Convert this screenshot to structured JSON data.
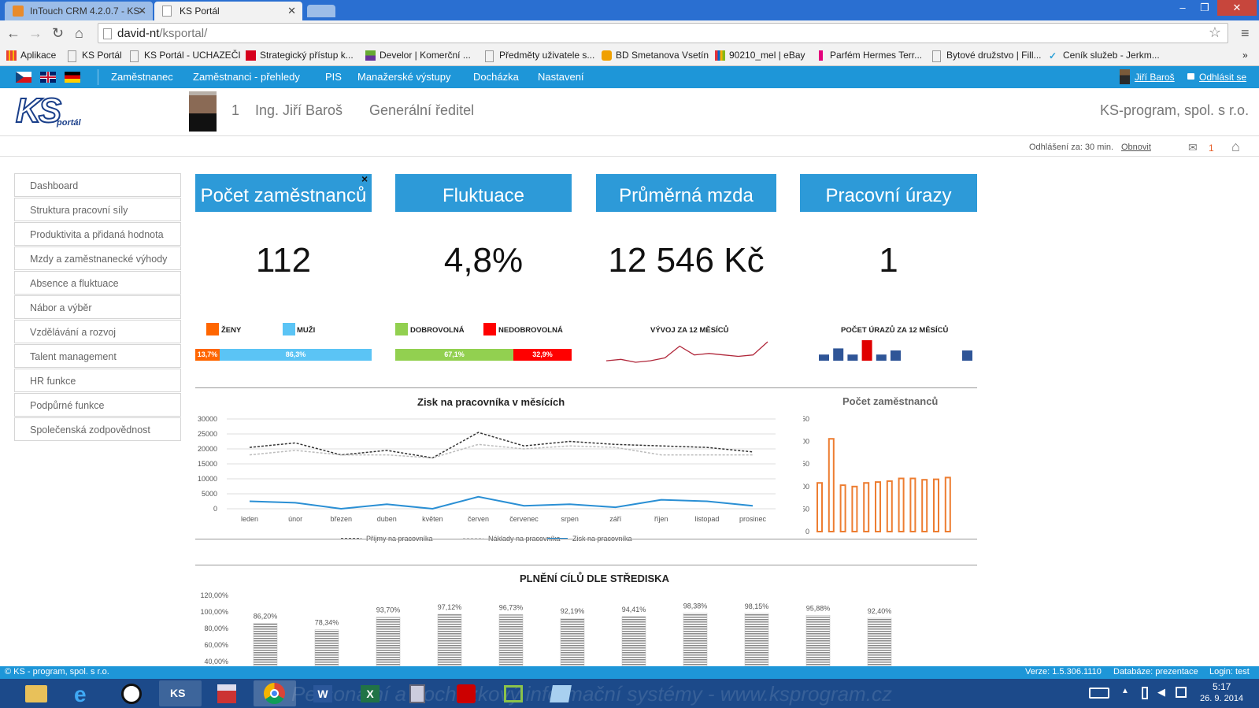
{
  "browser": {
    "tabs": [
      {
        "title": "InTouch CRM 4.2.0.7 - KS-",
        "active": false
      },
      {
        "title": "KS Portál",
        "active": true
      }
    ],
    "url_host": "david-nt",
    "url_path": "/ksportal/",
    "bookmarks": [
      "Aplikace",
      "KS Portál",
      "KS Portál - UCHAZEČI",
      "Strategický přístup k...",
      "Develor | Komerční ...",
      "Předměty uživatele s...",
      "BD Smetanova Vsetín",
      "90210_mel | eBay",
      "Parfém Hermes Terr...",
      "Bytové družstvo | Fill...",
      "Ceník služeb - Jerkm..."
    ]
  },
  "nav": {
    "items": [
      "Zaměstnanec",
      "Zaměstnanci - přehledy",
      "PIS",
      "Manažerské výstupy",
      "Docházka",
      "Nastavení"
    ],
    "user_link": "Jiří Baroš",
    "logout": "Odhlásit se"
  },
  "header": {
    "logo_text": "KS",
    "logo_sub": "portál",
    "user_number": "1",
    "user_name": "Ing. Jiří Baroš",
    "user_role": "Generální ředitel",
    "company": "KS-program, spol. s r.o."
  },
  "session": {
    "logout_in": "Odhlášení za: 30 min.",
    "refresh": "Obnovit",
    "messages": "1"
  },
  "sidebar": {
    "items": [
      "Dashboard",
      "Struktura pracovní síly",
      "Produktivita a přidaná hodnota",
      "Mzdy a zaměstnanecké výhody",
      "Absence a fluktuace",
      "Nábor a výběr",
      "Vzdělávání a rozvoj",
      "Talent management",
      "HR funkce",
      "Podpůrné funkce",
      "Společenská zodpovědnost"
    ]
  },
  "kpis": {
    "employees": {
      "title": "Počet zaměstnanců",
      "value": "112",
      "close": "×"
    },
    "turnover": {
      "title": "Fluktuace",
      "value": "4,8%"
    },
    "salary": {
      "title": "Průměrná mzda",
      "value": "12 546 Kč"
    },
    "injuries": {
      "title": "Pracovní úrazy",
      "value": "1"
    }
  },
  "gender": {
    "women_label": "ŽENY",
    "men_label": "MUŽI",
    "women_pct": "13,7%",
    "men_pct": "86,3%",
    "women_share": 0.137
  },
  "turnover_split": {
    "vol_label": "DOBROVOLNÁ",
    "invol_label": "NEDOBROVOLNÁ",
    "vol_pct": "67,1%",
    "invol_pct": "32,9%",
    "vol_share": 0.671
  },
  "salary_trend_label": "VÝVOJ ZA 12 MĚSÍCŮ",
  "injury_trend_label": "POČET ÚRAZŮ ZA 12 MĚSÍCŮ",
  "footer": {
    "copyright": "© KS - program, spol. s r.o.",
    "version": "Verze: 1.5.306.1110",
    "database": "Databáze: prezentace",
    "login": "Login: test"
  },
  "taskbar": {
    "banner": "Personální a docházkový informační systémy - www.ksprogram.cz",
    "time": "5:17",
    "date": "26. 9. 2014"
  },
  "colors": {
    "accent": "#2d9ad8",
    "women": "#ff6600",
    "men": "#5bc4f5",
    "vol": "#92d050",
    "invol": "#ff0000",
    "injury": "#2f5597",
    "injury_high": "#e00000"
  },
  "chart_data": [
    {
      "type": "line",
      "title": "Zisk na pracovníka v měsících",
      "categories": [
        "leden",
        "únor",
        "březen",
        "duben",
        "květen",
        "červen",
        "červenec",
        "srpen",
        "září",
        "říjen",
        "listopad",
        "prosinec"
      ],
      "ylim": [
        0,
        30000
      ],
      "yticks": [
        0,
        5000,
        10000,
        15000,
        20000,
        25000,
        30000
      ],
      "series": [
        {
          "name": "Příjmy na pracovníka",
          "values": [
            20500,
            22000,
            18000,
            19500,
            17000,
            25500,
            21000,
            22500,
            21500,
            21000,
            20500,
            19000
          ]
        },
        {
          "name": "Náklady na pracovníka",
          "values": [
            18000,
            19500,
            18000,
            18000,
            17000,
            21500,
            20000,
            21000,
            20500,
            18000,
            18000,
            18000
          ]
        },
        {
          "name": "Zisk na pracovníka",
          "values": [
            2500,
            2000,
            0,
            1500,
            0,
            4000,
            1000,
            1500,
            500,
            3000,
            2500,
            1000
          ]
        }
      ]
    },
    {
      "type": "bar",
      "title": "Počet zaměstnanců",
      "ylim": [
        0,
        250
      ],
      "yticks": [
        0,
        50,
        100,
        150,
        200,
        250
      ],
      "values": [
        108,
        206,
        103,
        100,
        108,
        110,
        112,
        118,
        118,
        115,
        116,
        120
      ]
    },
    {
      "type": "bar",
      "title": "PLNĚNÍ CÍLŮ DLE STŘEDISKA",
      "ylim": [
        40,
        120
      ],
      "yticks": [
        "40,00%",
        "60,00%",
        "80,00%",
        "100,00%",
        "120,00%"
      ],
      "values": [
        86.2,
        78.34,
        93.7,
        97.12,
        96.73,
        92.19,
        94.41,
        98.38,
        98.15,
        95.88,
        92.4
      ],
      "labels": [
        "86,20%",
        "78,34%",
        "93,70%",
        "97,12%",
        "96,73%",
        "92,19%",
        "94,41%",
        "98,38%",
        "98,15%",
        "95,88%",
        "92,40%"
      ]
    },
    {
      "type": "line",
      "title": "VÝVOJ ZA 12 MĚSÍCŮ",
      "values": [
        11900,
        11950,
        11850,
        11900,
        12000,
        12400,
        12100,
        12150,
        12100,
        12050,
        12100,
        12546
      ]
    },
    {
      "type": "bar",
      "title": "POČET ÚRAZŮ ZA 12 MĚSÍCŮ",
      "values": [
        0.3,
        0.6,
        0.3,
        1,
        0.3,
        0.5,
        0,
        0,
        0,
        0,
        0.5,
        0
      ]
    }
  ]
}
